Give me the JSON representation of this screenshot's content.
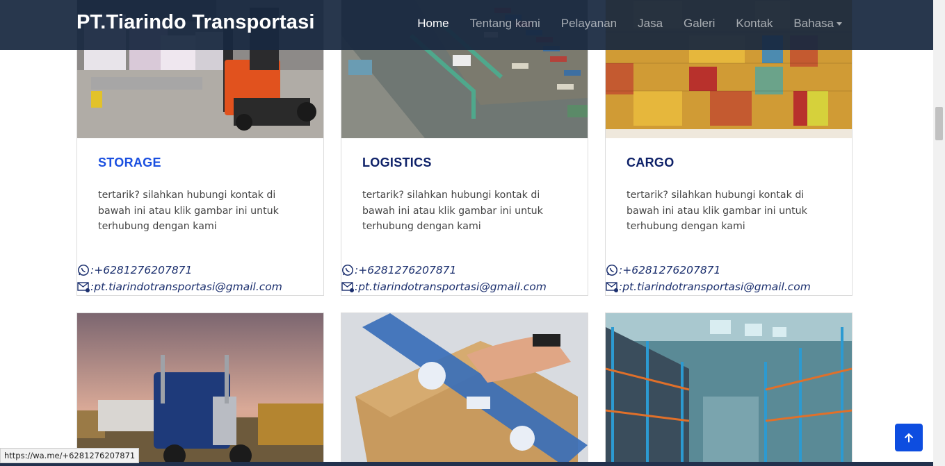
{
  "brand": "PT.Tiarindo Transportasi",
  "nav": [
    {
      "label": "Home",
      "active": true
    },
    {
      "label": "Tentang kami"
    },
    {
      "label": "Pelayanan"
    },
    {
      "label": "Jasa"
    },
    {
      "label": "Galeri"
    },
    {
      "label": "Kontak"
    },
    {
      "label": "Bahasa",
      "dropdown": true
    }
  ],
  "cards": [
    {
      "title": "STORAGE",
      "title_color": "#1a4fe0",
      "description": "tertarik? silahkan hubungi kontak di bawah ini atau klik gambar ini untuk terhubung dengan kami",
      "phone": ":+6281276207871",
      "email": ":pt.tiarindotransportasi@gmail.com"
    },
    {
      "title": "LOGISTICS",
      "title_color": "#0e2168",
      "description": "tertarik? silahkan hubungi kontak di bawah ini atau klik gambar ini untuk terhubung dengan kami",
      "phone": ":+6281276207871",
      "email": ":pt.tiarindotransportasi@gmail.com"
    },
    {
      "title": "CARGO",
      "title_color": "#0e2168",
      "description": "tertarik? silahkan hubungi kontak di bawah ini atau klik gambar ini untuk terhubung dengan kami",
      "phone": ":+6281276207871",
      "email": ":pt.tiarindotransportasi@gmail.com"
    }
  ],
  "status_url": "https://wa.me/+6281276207871",
  "colors": {
    "navbar": "#182840",
    "accent": "#0d4de0",
    "contact": "#1b2f6e"
  }
}
